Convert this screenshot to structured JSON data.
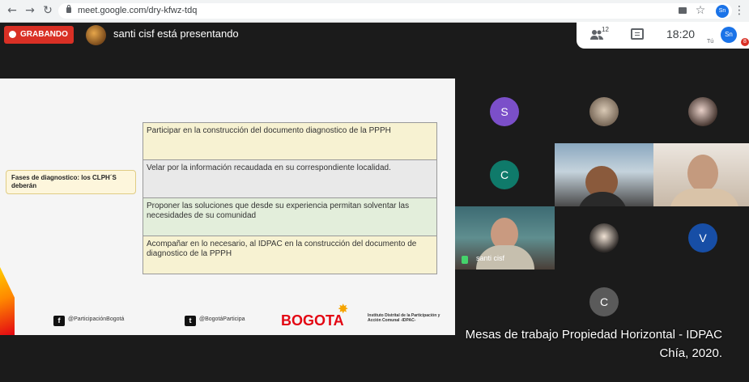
{
  "browser": {
    "url": "meet.google.com/dry-kfwz-tdq",
    "profile_initials": "Sn"
  },
  "meet": {
    "recording_label": "GRABANDO",
    "presenter_text": "santi cisf está presentando",
    "participant_count": "12",
    "time": "18:20",
    "self_label": "Tú",
    "self_initials": "Sn",
    "notification_count": "8"
  },
  "slide": {
    "label": "Fases de diagnostico: los CLPH´S deberán",
    "items": [
      "Participar en la construcción del documento diagnostico de la PPPH",
      "Velar por la información recaudada en su correspondiente localidad.",
      "Proponer las soluciones que desde su experiencia permitan solventar las necesidades de su comunidad",
      "Acompañar en lo necesario, al IDPAC en la construcción del documento de diagnostico de la PPPH"
    ],
    "item_colors": [
      "#f7f2d2",
      "#e9e9e9",
      "#e3eedb",
      "#f7f2d2"
    ],
    "facebook_handle": "@ParticipaciónBogotá",
    "twitter_handle": "@BogotáParticipa",
    "logo_text": "BOGOTA",
    "institute_text": "Instituto Distrital de la Participación y Acción Comunal -IDPAC-"
  },
  "participants": [
    {
      "initial": "S",
      "color": "#7b4fc9"
    },
    {
      "initial": "C",
      "color": "#0f7a6a"
    },
    {
      "initial": "V",
      "color": "#174ea6"
    },
    {
      "initial": "C",
      "color": "#5a5a5a"
    }
  ],
  "video_name": "santi cisf",
  "caption": {
    "line1": "Mesas de trabajo Propiedad Horizontal - IDPAC",
    "line2": "Chía, 2020."
  }
}
